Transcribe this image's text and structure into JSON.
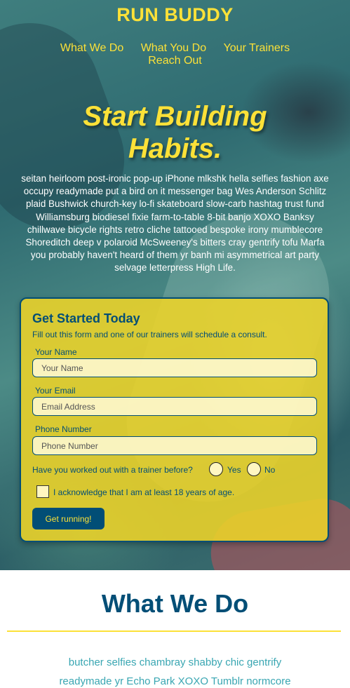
{
  "header": {
    "brand": "RUN BUDDY",
    "nav": [
      "What We Do",
      "What You Do",
      "Your Trainers",
      "Reach Out"
    ]
  },
  "hero": {
    "headline_line1": "Start Building",
    "headline_line2": "Habits.",
    "body": "seitan heirloom post-ironic pop-up iPhone mlkshk hella selfies fashion axe occupy readymade put a bird on it messenger bag Wes Anderson Schlitz plaid Bushwick church-key lo-fi skateboard slow-carb hashtag trust fund Williamsburg biodiesel fixie farm-to-table 8-bit banjo XOXO Banksy chillwave bicycle rights retro cliche tattooed bespoke irony mumblecore Shoreditch deep v polaroid McSweeney's bitters cray gentrify tofu Marfa you probably haven't heard of them yr banh mi asymmetrical art party selvage letterpress High Life."
  },
  "form": {
    "title": "Get Started Today",
    "subtitle": "Fill out this form and one of our trainers will schedule a consult.",
    "name_label": "Your Name",
    "name_placeholder": "Your Name",
    "email_label": "Your Email",
    "email_placeholder": "Email Address",
    "phone_label": "Phone Number",
    "phone_placeholder": "Phone Number",
    "question": "Have you worked out with a trainer before?",
    "radio_yes": "Yes",
    "radio_no": "No",
    "checkbox_label": "I acknowledge that I am at least 18 years of age.",
    "submit_label": "Get running!"
  },
  "what_we_do": {
    "title": "What We Do",
    "text": "butcher selfies chambray shabby chic gentrify readymade yr Echo Park XOXO Tumblr normcore"
  },
  "colors": {
    "accent_yellow": "#fce138",
    "navy": "#024e76",
    "teal_text": "#39a6b2"
  }
}
